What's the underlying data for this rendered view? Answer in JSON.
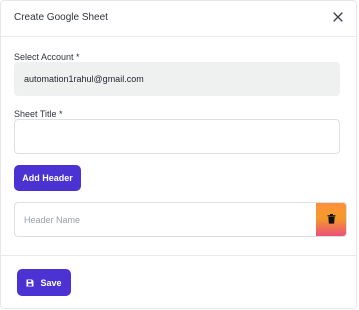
{
  "dialog": {
    "title": "Create Google Sheet",
    "close_icon": "close-icon"
  },
  "form": {
    "account_label": "Select Account *",
    "account_value": "automation1rahul@gmail.com",
    "sheet_title_label": "Sheet Title *",
    "sheet_title_value": "",
    "add_header_label": "Add Header",
    "header_name_placeholder": "Header Name",
    "delete_icon": "trash-icon"
  },
  "footer": {
    "save_label": "Save",
    "save_icon": "floppy-disk-icon"
  },
  "colors": {
    "primary": "#4a33d2",
    "delete_gradient": [
      "#ff8f3f",
      "#ec4f7a"
    ]
  }
}
